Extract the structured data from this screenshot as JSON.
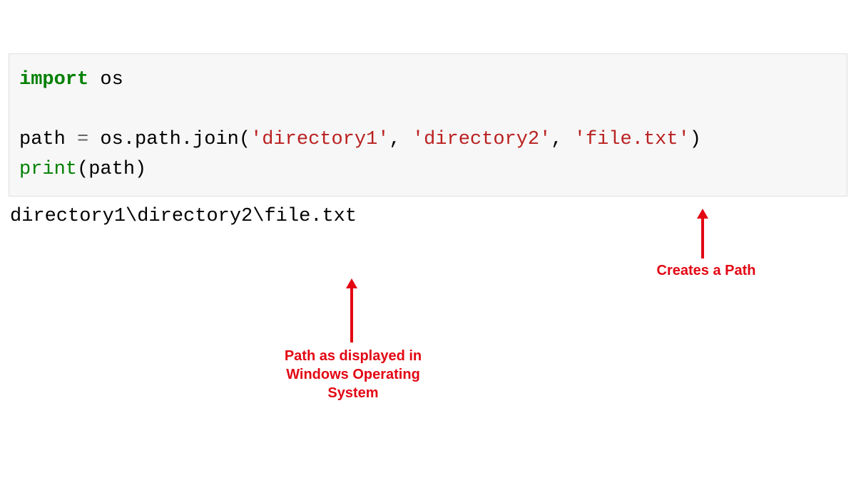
{
  "code": {
    "line1": {
      "import": "import",
      "os": " os"
    },
    "line3": {
      "path": "path ",
      "eq": "=",
      "ospathjoin": " os.path.join(",
      "str1": "'directory1'",
      "comma1": ", ",
      "str2": "'directory2'",
      "comma2": ", ",
      "str3": "'file.txt'",
      "close": ")"
    },
    "line4": {
      "print": "print",
      "arg": "(path)"
    }
  },
  "output": "directory1\\directory2\\file.txt",
  "annotations": {
    "creates_path": "Creates a Path",
    "path_display_l1": "Path as displayed in",
    "path_display_l2": "Windows Operating",
    "path_display_l3": "System"
  }
}
